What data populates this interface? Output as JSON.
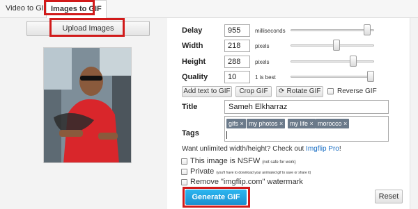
{
  "tabs": [
    {
      "label": "Video to GIF"
    },
    {
      "label": "Images to GIF"
    }
  ],
  "upload_label": "Upload Images",
  "settings": {
    "delay": {
      "label": "Delay",
      "value": "955",
      "unit": "milliseconds",
      "slider_level": 0.95
    },
    "width": {
      "label": "Width",
      "value": "218",
      "unit": "pixels",
      "slider_level": 0.55
    },
    "height": {
      "label": "Height",
      "value": "288",
      "unit": "pixels",
      "slider_level": 0.77
    },
    "quality": {
      "label": "Quality",
      "value": "10",
      "unit": "1 is best",
      "slider_level": 1.0
    }
  },
  "actions": {
    "add_text": "Add text to GIF",
    "crop": "Crop GIF",
    "rotate": "Rotate GIF",
    "reverse": "Reverse GIF"
  },
  "title": {
    "label": "Title",
    "value": "Sameh Elkharraz"
  },
  "tags": {
    "label": "Tags",
    "items": [
      "gifs",
      "my photos",
      "my life",
      "morocco"
    ],
    "remove_glyph": "×"
  },
  "pro": {
    "text": "Want unlimited width/height? Check out ",
    "link": "Imgflip Pro",
    "suffix": "!"
  },
  "options": {
    "nsfw": {
      "label": "This image is NSFW",
      "note": "(not safe for work)"
    },
    "private": {
      "label": "Private",
      "note": "(you'll have to download your animated gif to save or share it)"
    },
    "watermark": {
      "label": "Remove \"imgflip.com\" watermark"
    }
  },
  "generate_label": "Generate GIF",
  "reset_label": "Reset",
  "colors": {
    "accent": "#1a8fd0",
    "highlight": "#d11a1a",
    "tag_chip": "#6b7a8a"
  }
}
